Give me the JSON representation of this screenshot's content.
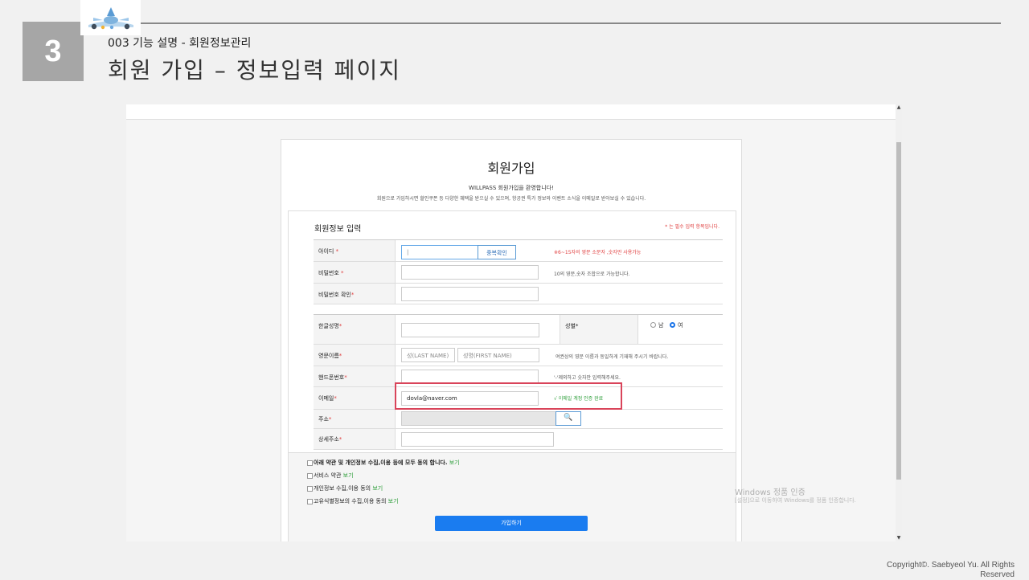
{
  "slide": {
    "number": "3",
    "subtitle": "003 기능 설명 - 회원정보관리",
    "title": "회원 가입 – 정보입력 페이지",
    "copyright": "Copyright©. Saebyeol Yu. All Rights Reserved"
  },
  "page": {
    "heading": "회원가입",
    "welcome": "WILLPASS 회원가입을 환영합니다!",
    "welcome_desc": "회원으로 가입하시면 할인쿠폰 등 다양한 혜택을 받으실 수 있으며, 항공권 특가 정보와 이벤트 소식을 이메일로 받아보실 수 있습니다.",
    "form_heading": "회원정보 입력",
    "required_note": "* 는 필수 입력 항목입니다."
  },
  "fields": {
    "id_label": "아이디",
    "id_value": "|",
    "dup_check_button": "중복확인",
    "id_hint": "※6~15자의 영문 소문자 ,숫자만 사용가능",
    "pw_label": "비밀번호",
    "pw_hint": "10의 영문,숫자 조합으로 가능합니다.",
    "pw_confirm_label": "비밀번호 확인",
    "korean_name_label": "한글성명",
    "gender_label": "성별",
    "gender_male": "남",
    "gender_female": "여",
    "gender_selected": "여",
    "english_name_label": "영문이름",
    "last_name_placeholder": "성(LAST NAME)",
    "first_name_placeholder": "성명(FIRST NAME)",
    "english_name_hint": "여권상의 영문 이름과 동일하게 기재해 주시기 바랍니다.",
    "phone_label": "핸드폰번호",
    "phone_hint": "'-'제외하고 숫자만 입력해주세요.",
    "email_label": "이메일",
    "email_value": "dovla@naver.com",
    "email_hint": "√ 이메일 계정 인증 완료",
    "address_label": "주소",
    "address_detail_label": "상세주소",
    "required_mark": "*"
  },
  "agreements": [
    {
      "text": "아래 약관 및 개인정보 수집,이용 등에 모두 동의 합니다.",
      "link": "보기",
      "bold": true
    },
    {
      "text": "서비스 약관",
      "link": "보기",
      "bold": false
    },
    {
      "text": "개인정보 수집,이용 동의",
      "link": "보기",
      "bold": false
    },
    {
      "text": "고유식별정보의 수집,이용 동의",
      "link": "보기",
      "bold": false
    }
  ],
  "submit_button": "가입하기",
  "watermark": {
    "line1": "Windows 정품 인증",
    "line2": "[설정]으로 이동하여 Windows를 정품 인증합니다."
  },
  "colors": {
    "accent": "#1a7cf0",
    "highlight": "#d9445a",
    "error": "#e04040",
    "success": "#2e9e3a"
  }
}
